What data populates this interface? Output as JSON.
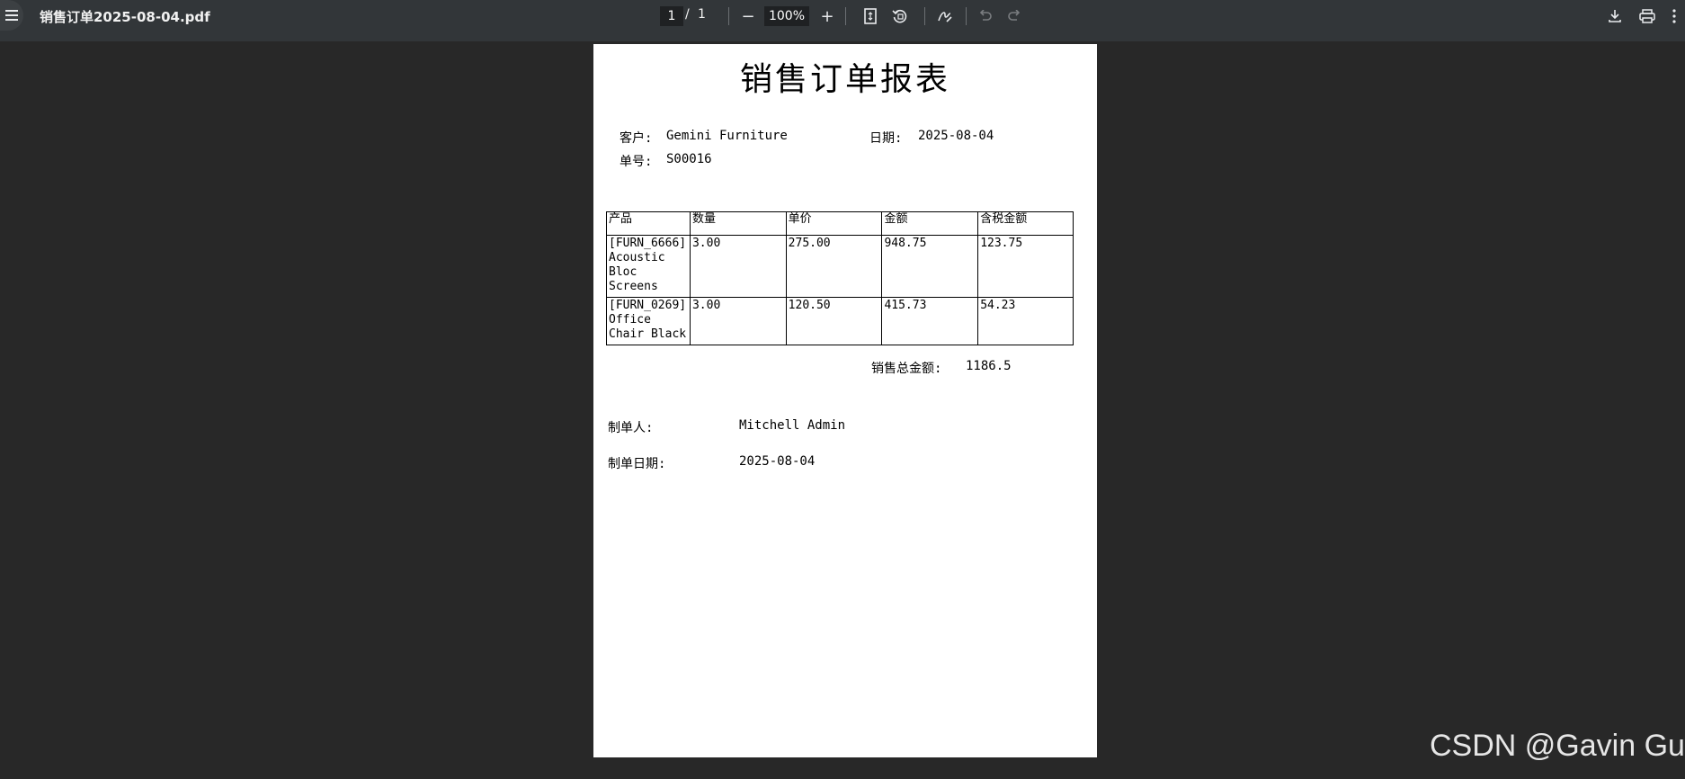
{
  "toolbar": {
    "file_title": "销售订单2025-08-04.pdf",
    "page_current": "1",
    "page_separator": "/",
    "page_total": "1",
    "zoom": "100%",
    "zoom_out": "−",
    "zoom_in": "+"
  },
  "document": {
    "title": "销售订单报表",
    "customer_label": "客户:",
    "customer_value": "Gemini Furniture",
    "date_label": "日期:",
    "date_value": "2025-08-04",
    "order_no_label": "单号:",
    "order_no_value": "S00016",
    "table": {
      "headers": [
        "产品",
        "数量",
        "单价",
        "金额",
        "含税金额"
      ],
      "rows": [
        {
          "product": "[FURN_6666] Acoustic Bloc Screens",
          "qty": "3.00",
          "unit_price": "275.00",
          "amount": "948.75",
          "tax_amount": "123.75"
        },
        {
          "product": "[FURN_0269] Office Chair Black",
          "qty": "3.00",
          "unit_price": "120.50",
          "amount": "415.73",
          "tax_amount": "54.23"
        }
      ]
    },
    "total_label": "销售总金额:",
    "total_value": "1186.5",
    "creator_label": "制单人:",
    "creator_value": "Mitchell Admin",
    "created_date_label": "制单日期:",
    "created_date_value": "2025-08-04"
  },
  "watermark": "CSDN @Gavin Gu"
}
